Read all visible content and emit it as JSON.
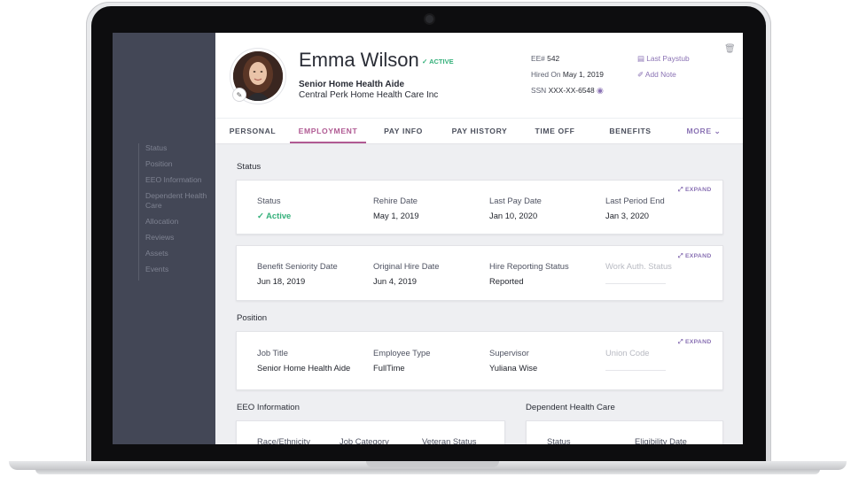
{
  "sidebar": {
    "items": [
      "Status",
      "Position",
      "EEO Information",
      "Dependent Health Care",
      "Allocation",
      "Reviews",
      "Assets",
      "Events"
    ]
  },
  "employee": {
    "name": "Emma Wilson",
    "status": "ACTIVE",
    "job_title": "Senior Home Health Aide",
    "company": "Central Perk Home Health Care Inc",
    "ee_label": "EE#",
    "ee_number": "542",
    "hired_label": "Hired On",
    "hired_on": "May 1, 2019",
    "ssn_label": "SSN",
    "ssn": "XXX-XX-6548"
  },
  "actions": {
    "last_paystub": "Last Paystub",
    "add_note": "Add Note"
  },
  "tabs": [
    "PERSONAL",
    "EMPLOYMENT",
    "PAY INFO",
    "PAY HISTORY",
    "TIME OFF",
    "BENEFITS",
    "MORE"
  ],
  "active_tab": "EMPLOYMENT",
  "expand_label": "EXPAND",
  "sections": {
    "status": {
      "title": "Status",
      "row1": [
        {
          "label": "Status",
          "value": "Active"
        },
        {
          "label": "Rehire Date",
          "value": "May 1, 2019"
        },
        {
          "label": "Last Pay Date",
          "value": "Jan 10, 2020"
        },
        {
          "label": "Last Period End",
          "value": "Jan 3, 2020"
        }
      ],
      "row2": [
        {
          "label": "Benefit Seniority Date",
          "value": "Jun 18, 2019"
        },
        {
          "label": "Original Hire Date",
          "value": "Jun 4, 2019"
        },
        {
          "label": "Hire Reporting Status",
          "value": "Reported"
        },
        {
          "label": "Work Auth. Status",
          "value": ""
        }
      ]
    },
    "position": {
      "title": "Position",
      "fields": [
        {
          "label": "Job Title",
          "value": "Senior Home Health Aide"
        },
        {
          "label": "Employee Type",
          "value": "FullTime"
        },
        {
          "label": "Supervisor",
          "value": "Yuliana Wise"
        },
        {
          "label": "Union Code",
          "value": ""
        }
      ]
    },
    "eeo": {
      "title": "EEO Information",
      "labels": [
        "Race/Ethnicity",
        "Job Category",
        "Veteran Status"
      ]
    },
    "dependent": {
      "title": "Dependent Health Care",
      "labels": [
        "Status",
        "Eligibility Date"
      ]
    }
  },
  "colors": {
    "sidebar": "#434756",
    "accent_purple": "#8a72b4",
    "active_tab": "#b05a93",
    "active_green": "#34b07a"
  }
}
